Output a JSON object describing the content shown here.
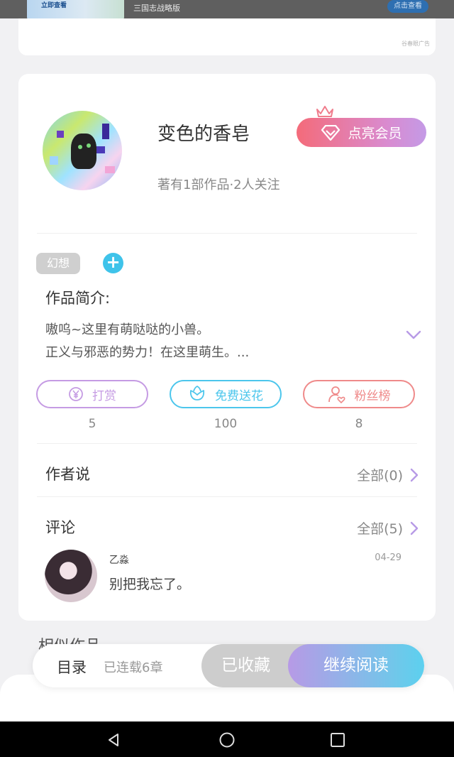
{
  "ad": {
    "thumb_label": "立即查看",
    "title": "三国志战略版",
    "button": "点击查看",
    "source": "谷春眼广告"
  },
  "author": {
    "name": "变色的香皂",
    "meta": "著有1部作品·2人关注",
    "vip_button": "点亮会员"
  },
  "tags": {
    "items": [
      "幻想"
    ],
    "add_icon": "+"
  },
  "intro": {
    "heading": "作品简介:",
    "lines": [
      "嗷呜~这里有萌哒哒的小兽。",
      "正义与邪恶的势力！在这里萌生。..."
    ]
  },
  "actions": [
    {
      "label": "打赏",
      "count": "5",
      "icon": "yen-coin-icon",
      "color": "#c59be3"
    },
    {
      "label": "免费送花",
      "count": "100",
      "icon": "flower-icon",
      "color": "#4cc6ec"
    },
    {
      "label": "粉丝榜",
      "count": "8",
      "icon": "fan-person-icon",
      "color": "#ef8a8a"
    }
  ],
  "author_says": {
    "title": "作者说",
    "link": "全部(0)"
  },
  "comments": {
    "title": "评论",
    "link": "全部(5)",
    "items": [
      {
        "user": "乙淼",
        "date": "04-29",
        "text": "别把我忘了。"
      }
    ]
  },
  "similar": {
    "title": "相似作品"
  },
  "bottom_bar": {
    "toc": "目录",
    "serial_info": "已连载6章",
    "collected": "已收藏",
    "continue": "继续阅读"
  },
  "colors": {
    "accent_purple": "#b79ae6",
    "accent_cyan": "#5cd0ef",
    "vip_pink": "#f46b7a"
  }
}
